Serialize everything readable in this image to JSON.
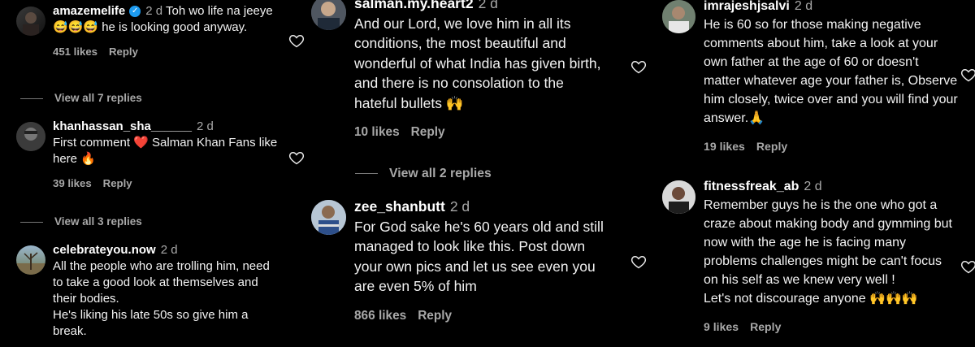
{
  "col1": {
    "c1": {
      "username": "amazemelife",
      "time": "2 d",
      "text": "Toh wo life na jeeye 😅😅😅 he is looking good anyway.",
      "likes": "451 likes",
      "reply": "Reply"
    },
    "view1": "View all 7 replies",
    "c2": {
      "username": "khanhassan_sha______",
      "time": "2 d",
      "text": "First comment ❤️ Salman Khan Fans like here 🔥",
      "likes": "39 likes",
      "reply": "Reply"
    },
    "view2": "View all 3 replies",
    "c3": {
      "username": "celebrateyou.now",
      "time": "2 d",
      "text": "All the people who are trolling him, need to take a good look at themselves and their bodies.\nHe's liking his late 50s so give him a break."
    }
  },
  "col2": {
    "c1": {
      "username": "salman.my.heart2",
      "time": "2 d",
      "text": "And our Lord, we love him in all its conditions, the most beautiful and wonderful of what India has given birth, and there is no consolation to the hateful bullets 🙌",
      "likes": "10 likes",
      "reply": "Reply"
    },
    "view1": "View all 2 replies",
    "c2": {
      "username": "zee_shanbutt",
      "time": "2 d",
      "text": "For God sake he's 60 years old and still managed to look like this. Post down your own pics and let us see even you are even 5% of him",
      "likes": "866 likes",
      "reply": "Reply"
    }
  },
  "col3": {
    "c1": {
      "username": "imrajeshjsalvi",
      "time": "2 d",
      "text": "He is 60 so for those making negative comments about him, take a look at your own father at the age of 60 or doesn't matter whatever age your father is, Observe him closely, twice over and you will find your answer.🙏",
      "likes": "19 likes",
      "reply": "Reply"
    },
    "c2": {
      "username": "fitnessfreak_ab",
      "time": "2 d",
      "text": "Remember guys he is the one who got a craze about making body and gymming but now with the age he is facing many problems challenges might be can't focus on his self as we knew very well !\nLet's not discourage anyone 🙌🙌🙌",
      "likes": "9 likes",
      "reply": "Reply"
    }
  },
  "icons": {
    "heart": "heart-outline-icon",
    "verified": "verified-badge-icon"
  }
}
